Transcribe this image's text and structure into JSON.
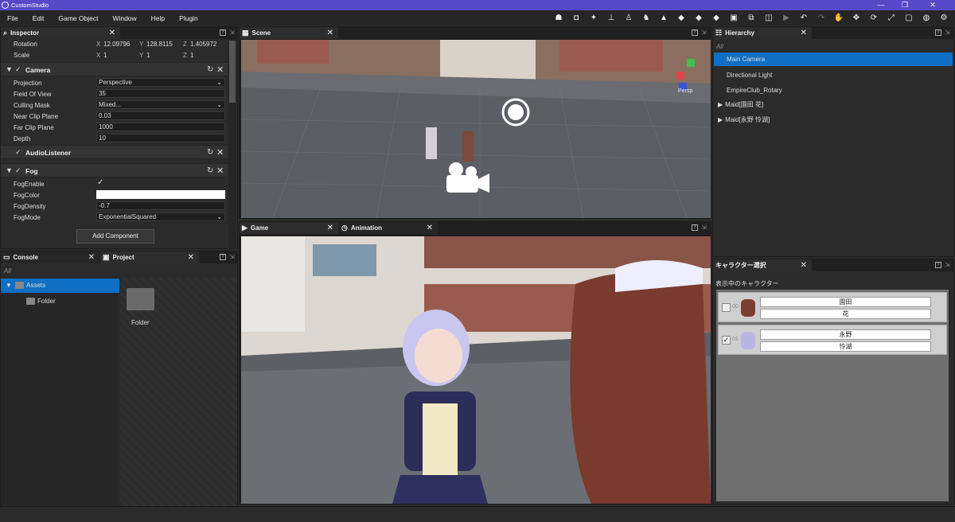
{
  "app": {
    "title": "CustomStudio"
  },
  "menu": [
    "File",
    "Edit",
    "Game Object",
    "Window",
    "Help",
    "Plugin"
  ],
  "tool_icons": [
    "character-icon",
    "camera-icon",
    "light-icon",
    "bone-icon",
    "pose-icon",
    "walk-icon",
    "stage-icon",
    "shape-icon",
    "shape2-icon",
    "shape3-icon",
    "shape4-icon",
    "frame-icon",
    "frame2-icon",
    "play-icon",
    "undo-icon",
    "redo-icon",
    "hand-icon",
    "move-icon",
    "rotate-icon",
    "scale-icon",
    "rect-icon",
    "globe-icon",
    "settings-icon"
  ],
  "inspector": {
    "title": "Inspector",
    "transform": {
      "rotation_label": "Rotation",
      "rx": "12.09796",
      "ry": "128.8115",
      "rz": "1.405972",
      "scale_label": "Scale",
      "sx": "1",
      "sy": "1",
      "sz": "1",
      "x": "X",
      "y": "Y",
      "z": "Z"
    },
    "camera": {
      "title": "Camera",
      "projection_label": "Projection",
      "projection": "Perspective",
      "fov_label": "Field Of View",
      "fov": "35",
      "culling_label": "Culling Mask",
      "culling": "Mixed...",
      "near_label": "Near Clip Plane",
      "near": "0.03",
      "far_label": "Far Clip Plane",
      "far": "1000",
      "depth_label": "Depth",
      "depth": "10"
    },
    "audio": {
      "title": "AudioListener"
    },
    "fog": {
      "title": "Fog",
      "enable_label": "FogEnable",
      "color_label": "FogColor",
      "color": "#ffffff",
      "density_label": "FogDensity",
      "density": "-0.7",
      "mode_label": "FogMode",
      "mode": "ExponentialSquared"
    },
    "add_component": "Add Component"
  },
  "console": {
    "title": "Console",
    "filter": "All"
  },
  "project": {
    "title": "Project",
    "tree": [
      {
        "label": "Assets"
      },
      {
        "label": "Folder"
      }
    ],
    "grid_item": "Folder"
  },
  "scene": {
    "title": "Scene",
    "persp": "Persp"
  },
  "game": {
    "title": "Game"
  },
  "animation": {
    "title": "Animation"
  },
  "hierarchy": {
    "title": "Hierarchy",
    "filter": "All",
    "items": [
      {
        "label": "Main Camera"
      },
      {
        "label": "Directional Light"
      },
      {
        "label": "EmpireClub_Rotary"
      },
      {
        "label": "Maid[園田 花]"
      },
      {
        "label": "Maid[永野 怜湖]"
      }
    ]
  },
  "chars": {
    "title": "キャラクター選択",
    "subtitle": "表示中のキャラクター",
    "list": [
      {
        "no": "00",
        "last": "園田",
        "first": "花",
        "checked": false
      },
      {
        "no": "01",
        "last": "永野",
        "first": "怜湖",
        "checked": true
      }
    ]
  },
  "colors": {
    "accent": "#5549c8",
    "selection": "#0e6fc4"
  }
}
